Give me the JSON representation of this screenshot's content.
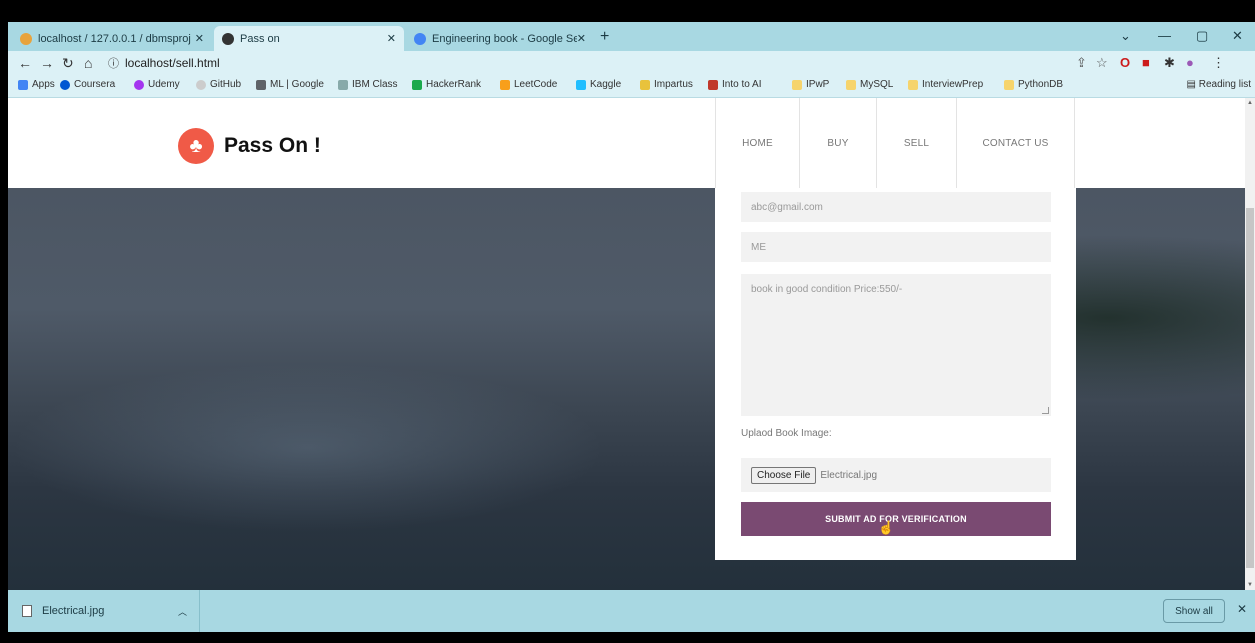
{
  "browser": {
    "tabs": [
      {
        "title": "localhost / 127.0.0.1 / dbmsproj",
        "favicon_color": "#e8a33c"
      },
      {
        "title": "Pass on",
        "favicon_color": "#333333"
      },
      {
        "title": "Engineering book - Google Searc",
        "favicon_color": "#4285f4"
      }
    ],
    "new_tab": "+",
    "url": "localhost/sell.html",
    "bookmarks": [
      {
        "label": "Apps",
        "icon": "apps-grid-icon"
      },
      {
        "label": "Coursera",
        "icon": "coursera-icon"
      },
      {
        "label": "Udemy",
        "icon": "udemy-icon"
      },
      {
        "label": "GitHub",
        "icon": "github-icon"
      },
      {
        "label": "ML | Google",
        "icon": "code-icon"
      },
      {
        "label": "IBM Class",
        "icon": "ibm-icon"
      },
      {
        "label": "HackerRank",
        "icon": "hackerrank-icon"
      },
      {
        "label": "LeetCode",
        "icon": "leetcode-icon"
      },
      {
        "label": "Kaggle",
        "icon": "kaggle-icon"
      },
      {
        "label": "Impartus",
        "icon": "impartus-icon"
      },
      {
        "label": "Into to AI",
        "icon": "shield-icon"
      },
      {
        "label": "IPwP",
        "icon": "folder-icon"
      },
      {
        "label": "MySQL",
        "icon": "folder-icon"
      },
      {
        "label": "InterviewPrep",
        "icon": "folder-icon"
      },
      {
        "label": "PythonDB",
        "icon": "folder-icon"
      }
    ],
    "reading_list": "Reading list"
  },
  "site": {
    "brand": "Pass On !",
    "accent": "#f05a47",
    "nav": [
      "HOME",
      "BUY",
      "SELL",
      "CONTACT US"
    ]
  },
  "form": {
    "email_value": "abc@gmail.com",
    "branch_value": "ME",
    "description_value": "book in good condition Price:550/-",
    "upload_label": "Uplaod Book Image:",
    "choose_file": "Choose File",
    "file_name": "Electrical.jpg",
    "submit_label": "SUBMIT AD FOR VERIFICATION",
    "submit_color": "#7a4a72"
  },
  "downloads": {
    "file": "Electrical.jpg",
    "show_all": "Show all"
  }
}
